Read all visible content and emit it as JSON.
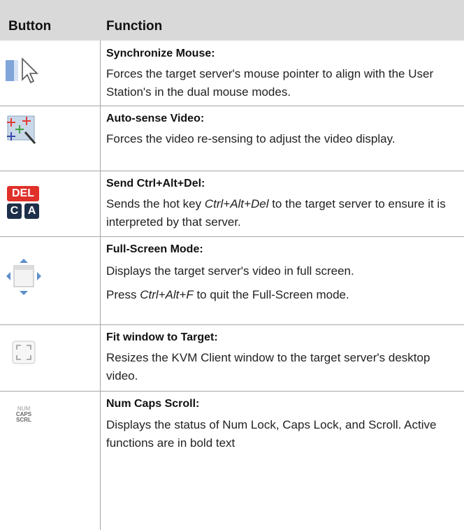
{
  "header": {
    "col1": "Button",
    "col2": "Function"
  },
  "rows": [
    {
      "title": "Synchronize Mouse",
      "colon": ":",
      "desc": "Forces the target server's mouse pointer to align with the User Station's in the dual mouse modes.",
      "icon": "sync-mouse-icon"
    },
    {
      "title": "Auto-sense Video",
      "colon": ":",
      "desc": "Forces the video re-sensing to adjust the video display.",
      "icon": "auto-sense-video-icon"
    },
    {
      "title": "Send Ctrl+Alt+Del",
      "colon": ":",
      "desc_pre": "Sends the hot key ",
      "desc_em": "Ctrl+Alt+Del",
      "desc_post": " to the target server to ensure it is interpreted by that server.",
      "icon": "ctrl-alt-del-icon",
      "icon_text": {
        "top": "DEL",
        "bl": "C",
        "br": "A"
      }
    },
    {
      "title": "Full-Screen Mode",
      "colon": ":",
      "desc": "Displays the target server's video in full screen.",
      "desc2_pre": "Press ",
      "desc2_em": "Ctrl+Alt+F",
      "desc2_post": " to quit the Full-Screen mode.",
      "icon": "full-screen-icon"
    },
    {
      "title": "Fit window to Target",
      "colon": ":",
      "desc": "Resizes the KVM Client window to the target server's desktop video.",
      "icon": "fit-window-icon"
    },
    {
      "title": "Num Caps Scroll:",
      "colon": "",
      "desc": "Displays the status of Num Lock, Caps Lock, and Scroll. Active functions are in bold text",
      "icon": "num-caps-scroll-icon",
      "icon_text": {
        "l1": "NUM",
        "l2": "CAPS",
        "l3": "SCRL"
      }
    }
  ]
}
